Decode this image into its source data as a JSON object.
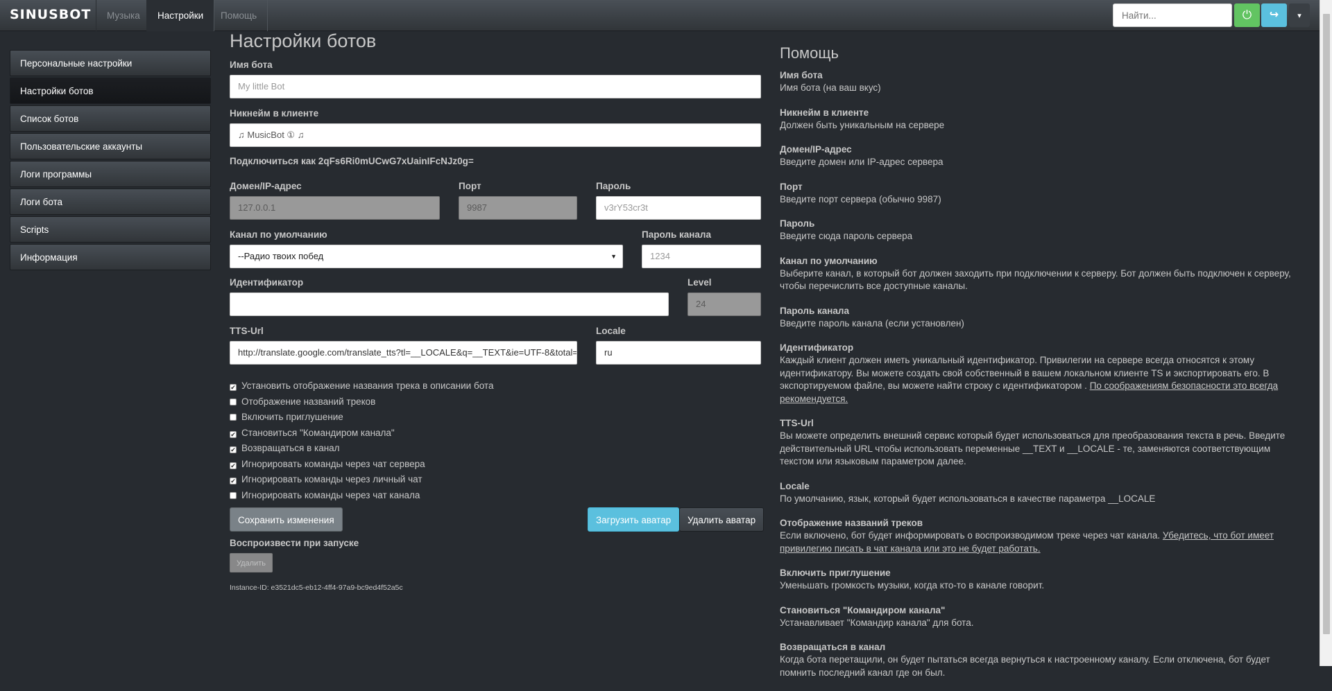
{
  "navbar": {
    "brand": "SINUSBOT",
    "tabs": [
      "Музыка",
      "Настройки",
      "Помощь"
    ],
    "active_tab": "Настройки",
    "search_placeholder": "Найти...",
    "power_icon": "⏻",
    "logout_icon": "↪",
    "dropdown_icon": "▾",
    "colors": {
      "power": "#62c462",
      "logout": "#5bc0de"
    }
  },
  "sidebar": {
    "items": [
      {
        "label": "Персональные настройки",
        "active": false
      },
      {
        "label": "Настройки ботов",
        "active": true
      },
      {
        "label": "Список ботов",
        "active": false
      },
      {
        "label": "Пользовательские аккаунты",
        "active": false
      },
      {
        "label": "Логи программы",
        "active": false
      },
      {
        "label": "Логи бота",
        "active": false
      },
      {
        "label": "Scripts",
        "active": false
      },
      {
        "label": "Информация",
        "active": false
      }
    ]
  },
  "form": {
    "title": "Настройки ботов",
    "bot_name": {
      "label": "Имя бота",
      "placeholder": "My little Bot",
      "value": ""
    },
    "nickname": {
      "label": "Никнейм в клиенте",
      "value": "♫ MusicBot ① ♫"
    },
    "connect_as": "Подключиться как 2qFs6Ri0mUCwG7xUainIFcNJz0g=",
    "host": {
      "label": "Домен/IP-адрес",
      "value": "127.0.0.1"
    },
    "port": {
      "label": "Порт",
      "value": "9987"
    },
    "password": {
      "label": "Пароль",
      "placeholder": "v3rY53cr3t"
    },
    "default_channel": {
      "label": "Канал по умолчанию",
      "value": "--Радио твоих побед"
    },
    "channel_password": {
      "label": "Пароль канала",
      "placeholder": "1234"
    },
    "identity": {
      "label": "Идентификатор",
      "value": ""
    },
    "level": {
      "label": "Level",
      "value": "24"
    },
    "tts_url": {
      "label": "TTS-Url",
      "value": "http://translate.google.com/translate_tts?tl=__LOCALE&q=__TEXT&ie=UTF-8&total="
    },
    "locale": {
      "label": "Locale",
      "value": "ru"
    },
    "checkboxes": [
      {
        "label": "Установить отображение названия трека в описании бота",
        "checked": true
      },
      {
        "label": "Отображение названий треков",
        "checked": false
      },
      {
        "label": "Включить приглушение",
        "checked": false
      },
      {
        "label": "Становиться \"Командиром канала\"",
        "checked": true
      },
      {
        "label": "Возвращаться в канал",
        "checked": true
      },
      {
        "label": "Игнорировать команды через чат сервера",
        "checked": true
      },
      {
        "label": "Игнорировать команды через личный чат",
        "checked": true
      },
      {
        "label": "Игнорировать команды через чат канала",
        "checked": false
      }
    ],
    "save_label": "Сохранить изменения",
    "upload_avatar_label": "Загрузить аватар",
    "delete_avatar_label": "Удалить аватар",
    "play_on_start": "Воспроизвести при запуске",
    "delete_label": "Удалить",
    "instance_id": "Instance-ID: e3521dc5-eb12-4ff4-97a9-bc9ed4f52a5c"
  },
  "help": {
    "title": "Помощь",
    "sections": [
      {
        "title": "Имя бота",
        "text": "Имя бота (на ваш вкус)"
      },
      {
        "title": "Никнейм в клиенте",
        "text": "Должен быть уникальным на сервере"
      },
      {
        "title": "Домен/IP-адрес",
        "text": "Введите домен или IP-адрес сервера"
      },
      {
        "title": "Порт",
        "text": "Введите порт сервера (обычно 9987)"
      },
      {
        "title": "Пароль",
        "text": "Введите сюда пароль сервера"
      },
      {
        "title": "Канал по умолчанию",
        "text": "Выберите канал, в который бот должен заходить при подключении к серверу. Бот должен быть подключен к серверу, чтобы перечислить все доступные каналы."
      },
      {
        "title": "Пароль канала",
        "text": "Введите пароль канала (если установлен)"
      },
      {
        "title": "Идентификатор",
        "text": "Каждый клиент должен иметь уникальный идентификатор. Привилегии на сервере всегда относятся к этому идентификатору. Вы можете создать свой собственный в вашем локальном клиенте TS и экспортировать его. В экспортируемом файле, вы можете найти строку с идентификатором .",
        "underline": "По соображениям безопасности это всегда рекомендуется."
      },
      {
        "title": "TTS-Url",
        "text": "Вы можете определить внешний сервис который будет использоваться для преобразования текста в речь. Введите действительный URL чтобы использовать переменные __TEXT и __LOCALE - те, заменяются соответствующим текстом или языковым параметром далее."
      },
      {
        "title": "Locale",
        "text": "По умолчанию, язык, который будет использоваться в качестве параметра __LOCALE"
      },
      {
        "title": "Отображение названий треков",
        "text": "Если включено, бот будет информировать о воспроизводимом треке через чат канала.",
        "underline": "Убедитесь, что бот имеет привилегию писать в чат канала или это не будет работать."
      },
      {
        "title": "Включить приглушение",
        "text": "Уменьшать громкость музыки, когда кто-то в канале говорит."
      },
      {
        "title": "Становиться \"Командиром канала\"",
        "text": "Устанавливает \"Командир канала\" для бота."
      },
      {
        "title": "Возвращаться в канал",
        "text": "Когда бота перетащили, он будет пытаться всегда вернуться к настроенному каналу. Если отключена, бот будет помнить последний канал где он был."
      }
    ]
  }
}
